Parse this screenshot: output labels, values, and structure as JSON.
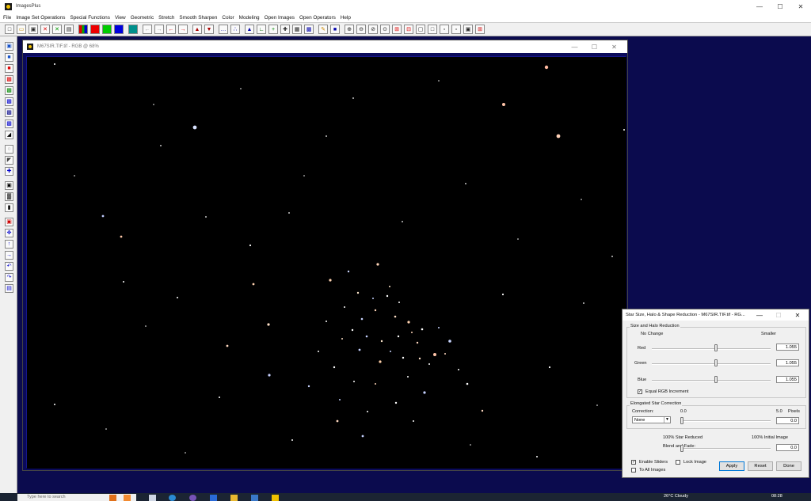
{
  "app": {
    "title": "ImagesPlus"
  },
  "menu": [
    "File",
    "Image Set Operations",
    "Special Functions",
    "View",
    "Geometric",
    "Stretch",
    "Smooth Sharpen",
    "Color",
    "Modeling",
    "Open Images",
    "Open Operators",
    "Help"
  ],
  "image_window": {
    "title": "M67SIR.TIF.tif - RGB @ 68%"
  },
  "dialog": {
    "title": "Star Size, Halo & Shape Reduction - M67SIR.TIF.tif - RG...",
    "size_halo_group": "Size and Halo Reduction",
    "no_change": "No Change",
    "smaller": "Smaller",
    "sliders": [
      {
        "label": "Red",
        "value": "1.055",
        "level": 0.54
      },
      {
        "label": "Green",
        "value": "1.055",
        "level": 0.54
      },
      {
        "label": "Blue",
        "value": "1.055",
        "level": 0.54
      }
    ],
    "equal_rgb": {
      "label": "Equal RGB Increment",
      "checked": true
    },
    "elongated_group": "Elongated Star Correction",
    "correction_label": "Correction:",
    "correction_value": "None",
    "scale_min": "0.0",
    "scale_max": "5.0",
    "pixels_label": "Pixels",
    "correction_amount": "0.0",
    "correction_level": 0.0,
    "reduced_label": "100% Star Reduced",
    "initial_label": "100% Initial Image",
    "blend_label": "Blend and Fade:",
    "blend_value": "0.0",
    "blend_level": 0.0,
    "enable_sliders": {
      "label": "Enable Sliders",
      "checked": true
    },
    "lock_image": {
      "label": "Lock Image",
      "checked": false
    },
    "to_all_images": {
      "label": "To All Images",
      "checked": false
    },
    "apply": "Apply",
    "reset": "Reset",
    "done": "Done"
  },
  "taskbar": {
    "search_placeholder": "Type here to search",
    "weather": "26°C  Cloudy",
    "time": "08:28"
  },
  "colors": {
    "canvas": "#0b0b4e",
    "starfield": "#000000",
    "accent": "#0078d7"
  }
}
